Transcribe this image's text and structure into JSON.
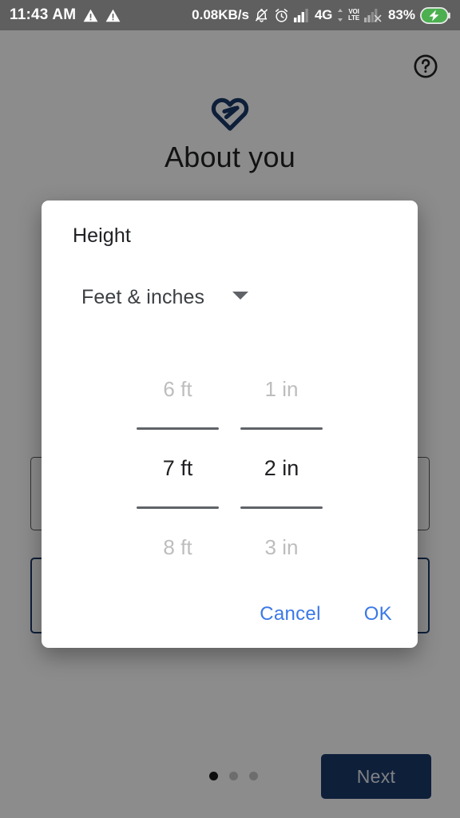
{
  "status_bar": {
    "time": "11:43 AM",
    "icons_left": [
      "warning-triangle-icon",
      "warning-triangle-icon"
    ],
    "network_speed": "0.08KB/s",
    "icons_right": [
      "bell-muted-icon",
      "alarm-clock-icon",
      "signal-bars-icon"
    ],
    "network_type": "4G",
    "volte_top": "VOI",
    "volte_bottom": "LTE",
    "second_signal": "signal-bars-crossed-icon",
    "battery_percent": "83%",
    "battery_icon": "battery-charging-icon"
  },
  "page": {
    "help_icon": "help-circle-icon",
    "logo_icon": "google-fit-heart-icon",
    "title": "About you",
    "pager": {
      "total": 3,
      "active_index": 0
    },
    "next_label": "Next"
  },
  "dialog": {
    "title": "Height",
    "unit_selector": {
      "value": "Feet & inches",
      "caret_icon": "chevron-down-icon"
    },
    "pickers": [
      {
        "name": "feet",
        "previous": "6 ft",
        "selected": "7 ft",
        "next": "8 ft"
      },
      {
        "name": "inches",
        "previous": "1 in",
        "selected": "2 in",
        "next": "3 in"
      }
    ],
    "cancel_label": "Cancel",
    "ok_label": "OK"
  },
  "colors": {
    "accent_blue": "#3b78e7",
    "brand_navy": "#1b3a6b",
    "scrim": "rgba(0,0,0,0.45)",
    "battery_green": "#4caf50"
  }
}
